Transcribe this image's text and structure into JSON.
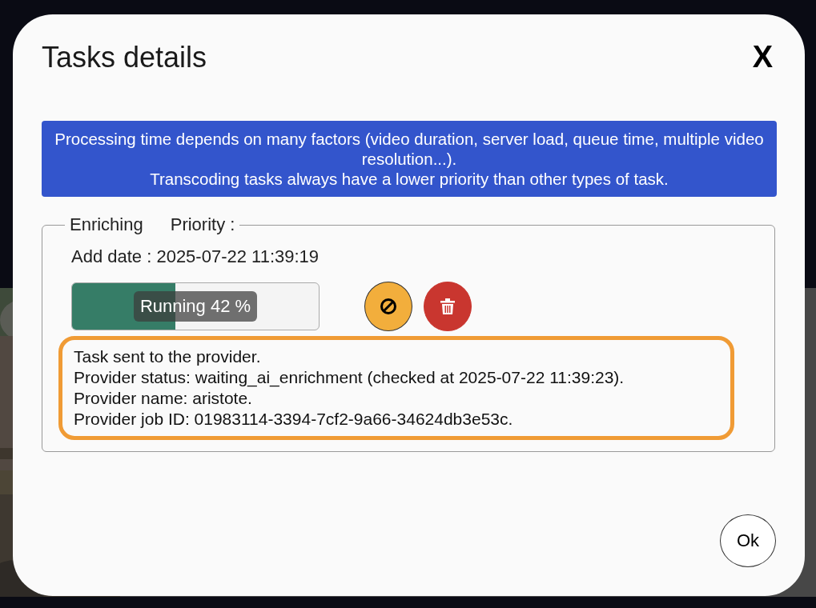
{
  "dialog": {
    "title": "Tasks details",
    "close_label": "X"
  },
  "notice": {
    "lines": [
      "Processing time depends on many factors (video duration, server load, queue time, multiple video resolution...).",
      "Transcoding tasks always have a lower priority than other types of task."
    ]
  },
  "task": {
    "type": "Enriching",
    "priority_label": "Priority :",
    "add_date": "Add date : 2025-07-22 11:39:19",
    "progress": {
      "label": "Running 42 %",
      "level": 0.42
    },
    "actions": [
      {
        "kind": "cancel"
      },
      {
        "kind": "delete"
      }
    ],
    "log": [
      "Task sent to the provider.",
      "Provider status: waiting_ai_enrichment (checked at 2025-07-22 11:39:23).",
      "Provider name: aristote.",
      "Provider job ID: 01983114-3394-7cf2-9a66-34624db3e53c."
    ]
  },
  "buttons": [
    "Ok"
  ]
}
